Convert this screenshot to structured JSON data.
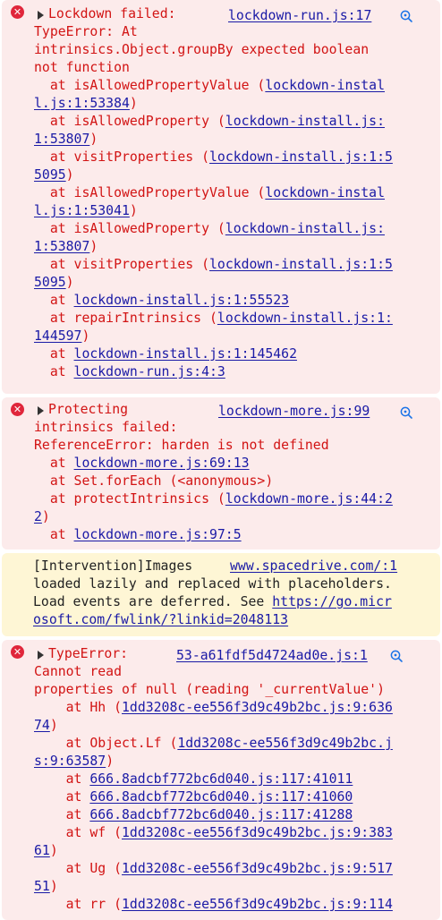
{
  "icons": {
    "error": "error-circle-x-icon",
    "expand": "expand-triangle-icon",
    "insights": "magnifier-insights-icon"
  },
  "colors": {
    "error_bg": "#fcebeb",
    "error_text": "#d21414",
    "warn_bg": "#fef6d5",
    "link": "#1a1aa6",
    "error_icon": "#e0263b"
  },
  "entries": [
    {
      "type": "error",
      "source": "lockdown-run.js:17",
      "lines": [
        [
          {
            "t": "Lockdown failed:"
          }
        ],
        [
          {
            "t": "TypeError: At"
          }
        ],
        [
          {
            "t": "intrinsics.Object.groupBy expected boolean"
          }
        ],
        [
          {
            "t": "not function"
          }
        ],
        [
          {
            "t": "  at isAllowedPropertyValue ("
          },
          {
            "t": "lockdown-instal",
            "l": true
          }
        ],
        [
          {
            "t": "l.js:1:53384",
            "l": true
          },
          {
            "t": ")"
          }
        ],
        [
          {
            "t": "  at isAllowedProperty ("
          },
          {
            "t": "lockdown-install.js:",
            "l": true
          }
        ],
        [
          {
            "t": "1:53807",
            "l": true
          },
          {
            "t": ")"
          }
        ],
        [
          {
            "t": "  at visitProperties ("
          },
          {
            "t": "lockdown-install.js:1:5",
            "l": true
          }
        ],
        [
          {
            "t": "5095",
            "l": true
          },
          {
            "t": ")"
          }
        ],
        [
          {
            "t": "  at isAllowedPropertyValue ("
          },
          {
            "t": "lockdown-instal",
            "l": true
          }
        ],
        [
          {
            "t": "l.js:1:53041",
            "l": true
          },
          {
            "t": ")"
          }
        ],
        [
          {
            "t": "  at isAllowedProperty ("
          },
          {
            "t": "lockdown-install.js:",
            "l": true
          }
        ],
        [
          {
            "t": "1:53807",
            "l": true
          },
          {
            "t": ")"
          }
        ],
        [
          {
            "t": "  at visitProperties ("
          },
          {
            "t": "lockdown-install.js:1:5",
            "l": true
          }
        ],
        [
          {
            "t": "5095",
            "l": true
          },
          {
            "t": ")"
          }
        ],
        [
          {
            "t": "  at "
          },
          {
            "t": "lockdown-install.js:1:55523",
            "l": true
          }
        ],
        [
          {
            "t": "  at repairIntrinsics ("
          },
          {
            "t": "lockdown-install.js:1:",
            "l": true
          }
        ],
        [
          {
            "t": "144597",
            "l": true
          },
          {
            "t": ")"
          }
        ],
        [
          {
            "t": "  at "
          },
          {
            "t": "lockdown-install.js:1:145462",
            "l": true
          }
        ],
        [
          {
            "t": "  at "
          },
          {
            "t": "lockdown-run.js:4:3",
            "l": true
          }
        ]
      ]
    },
    {
      "type": "error",
      "source": "lockdown-more.js:99",
      "lines": [
        [
          {
            "t": "Protecting"
          }
        ],
        [
          {
            "t": "intrinsics failed:"
          }
        ],
        [
          {
            "t": "ReferenceError: harden is not defined"
          }
        ],
        [
          {
            "t": "  at "
          },
          {
            "t": "lockdown-more.js:69:13",
            "l": true
          }
        ],
        [
          {
            "t": "  at Set.forEach (<anonymous>)"
          }
        ],
        [
          {
            "t": "  at protectIntrinsics ("
          },
          {
            "t": "lockdown-more.js:44:2",
            "l": true
          }
        ],
        [
          {
            "t": "2",
            "l": true
          },
          {
            "t": ")"
          }
        ],
        [
          {
            "t": "  at "
          },
          {
            "t": "lockdown-more.js:97:5",
            "l": true
          }
        ]
      ]
    },
    {
      "type": "warn",
      "source": "www.spacedrive.com/:1",
      "lines": [
        [
          {
            "t": "[Intervention]Images"
          }
        ],
        [
          {
            "t": "loaded lazily and replaced with placeholders."
          }
        ],
        [
          {
            "t": "Load events are deferred. See "
          },
          {
            "t": "https://go.micr",
            "l": true
          }
        ],
        [
          {
            "t": "osoft.com/fwlink/?linkid=2048113",
            "l": true
          }
        ]
      ]
    },
    {
      "type": "error",
      "source": "53-a61fdf5d4724ad0e.js:1",
      "lines": [
        [
          {
            "t": "TypeError:"
          }
        ],
        [
          {
            "t": "Cannot read"
          }
        ],
        [
          {
            "t": "properties of null (reading '_currentValue')"
          }
        ],
        [
          {
            "t": "    at Hh ("
          },
          {
            "t": "1dd3208c-ee556f3d9c49b2bc.js:9:636",
            "l": true
          }
        ],
        [
          {
            "t": "74",
            "l": true
          },
          {
            "t": ")"
          }
        ],
        [
          {
            "t": "    at Object.Lf ("
          },
          {
            "t": "1dd3208c-ee556f3d9c49b2bc.j",
            "l": true
          }
        ],
        [
          {
            "t": "s:9:63587",
            "l": true
          },
          {
            "t": ")"
          }
        ],
        [
          {
            "t": "    at "
          },
          {
            "t": "666.8adcbf772bc6d040.js:117:41011",
            "l": true
          }
        ],
        [
          {
            "t": "    at "
          },
          {
            "t": "666.8adcbf772bc6d040.js:117:41060",
            "l": true
          }
        ],
        [
          {
            "t": "    at "
          },
          {
            "t": "666.8adcbf772bc6d040.js:117:41288",
            "l": true
          }
        ],
        [
          {
            "t": "    at wf ("
          },
          {
            "t": "1dd3208c-ee556f3d9c49b2bc.js:9:383",
            "l": true
          }
        ],
        [
          {
            "t": "61",
            "l": true
          },
          {
            "t": ")"
          }
        ],
        [
          {
            "t": "    at Ug ("
          },
          {
            "t": "1dd3208c-ee556f3d9c49b2bc.js:9:517",
            "l": true
          }
        ],
        [
          {
            "t": "51",
            "l": true
          },
          {
            "t": ")"
          }
        ],
        [
          {
            "t": "    at rr ("
          },
          {
            "t": "1dd3208c-ee556f3d9c49b2bc.js:9:114",
            "l": true
          }
        ]
      ]
    }
  ]
}
